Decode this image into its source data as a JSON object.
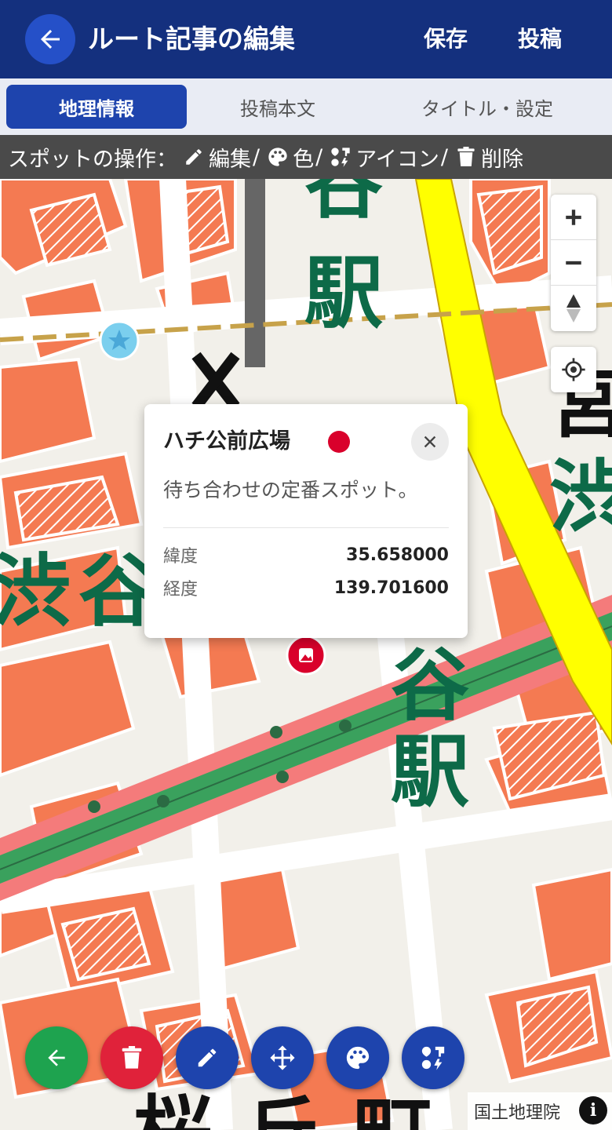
{
  "header": {
    "title": "ルート記事の編集",
    "save_label": "保存",
    "post_label": "投稿"
  },
  "tabs": [
    {
      "label": "地理情報",
      "active": true
    },
    {
      "label": "投稿本文",
      "active": false
    },
    {
      "label": "タイトル・設定",
      "active": false
    }
  ],
  "spot_bar": {
    "prefix": "スポットの操作：",
    "edit": "編集",
    "color": "色",
    "icon": "アイコン",
    "delete": "削除",
    "separator": "/"
  },
  "map": {
    "labels": {
      "station_top": "駅",
      "station_top_upper": "谷",
      "station_main_1": "谷",
      "station_main_2": "駅",
      "shibuya_1": "渋",
      "shibuya_2": "谷",
      "shibuya_right": "渋",
      "miya": "宮",
      "sakura": "桜",
      "oka": "丘",
      "machi": "町"
    },
    "controls": {
      "zoom_in_icon": "plus-icon",
      "zoom_out_icon": "minus-icon",
      "compass_icon": "compass-icon",
      "locate_icon": "crosshair-icon"
    }
  },
  "popup": {
    "title": "ハチ公前広場",
    "marker_color": "#d9002b",
    "description": "待ち合わせの定番スポット。",
    "lat_label": "緯度",
    "lat_value": "35.658000",
    "lng_label": "経度",
    "lng_value": "139.701600"
  },
  "fab": [
    {
      "name": "back",
      "color": "#1ea34f",
      "icon": "arrow-left-icon"
    },
    {
      "name": "delete",
      "color": "#e0223a",
      "icon": "trash-icon"
    },
    {
      "name": "edit",
      "color": "#1e44ad",
      "icon": "pencil-icon"
    },
    {
      "name": "move",
      "color": "#1e44ad",
      "icon": "move-icon"
    },
    {
      "name": "color",
      "color": "#1e44ad",
      "icon": "palette-icon"
    },
    {
      "name": "icon",
      "color": "#1e44ad",
      "icon": "icons-icon"
    }
  ],
  "attribution": "国土地理院",
  "colors": {
    "header": "#14307e",
    "accent": "#1e44ad",
    "building": "#f47a52",
    "rail": "#3aa15d",
    "highway": "#ffff00",
    "rail_buffer": "#f47b7b",
    "map_text": "#0d6a48"
  }
}
